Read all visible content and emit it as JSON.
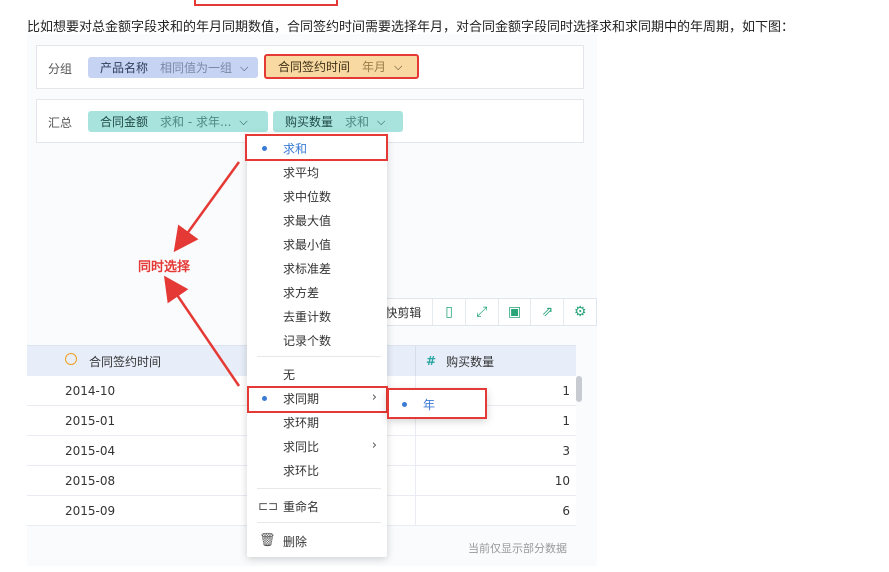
{
  "intro": "比如想要对总金额字段求和的年月同期数值，合同签约时间需要选择年月，对合同金额字段同时选择求和求同期中的年周期，如下图：",
  "group": {
    "label": "分组",
    "pill1": {
      "name": "产品名称",
      "sub": "相同值为一组"
    },
    "pill2": {
      "name": "合同签约时间",
      "sub": "年月"
    }
  },
  "summary": {
    "label": "汇总",
    "pill1": {
      "name": "合同金额",
      "sub": "求和 - 求年..."
    },
    "pill2": {
      "name": "购买数量",
      "sub": "求和"
    }
  },
  "menu": {
    "items": [
      "求和",
      "求平均",
      "求中位数",
      "求最大值",
      "求最小值",
      "求标准差",
      "求方差",
      "去重计数",
      "记录个数"
    ],
    "items2": [
      "无",
      "求同期",
      "求环期",
      "求同比",
      "求环比"
    ],
    "rename": "重命名",
    "delete": "删除"
  },
  "submenu": {
    "item": "年"
  },
  "toolbar": {
    "add_label": "添加到快剪辑",
    "icons": [
      "tablet-icon",
      "expand-icon",
      "save-icon",
      "export-icon",
      "gear-icon"
    ]
  },
  "table": {
    "col1": "合同签约时间",
    "col2": "购买数量",
    "rows": [
      {
        "date": "2014-10",
        "qty": "1"
      },
      {
        "date": "2015-01",
        "qty": "1"
      },
      {
        "date": "2015-04",
        "qty": "3"
      },
      {
        "date": "2015-08",
        "qty": "10"
      },
      {
        "date": "2015-09",
        "qty": "6"
      }
    ]
  },
  "annotation": "同时选择",
  "footer": "当前仅显示部分数据",
  "colors": {
    "accent": "#3a7bd5",
    "highlight": "#e53935",
    "toolbar": "#2aa57a"
  }
}
